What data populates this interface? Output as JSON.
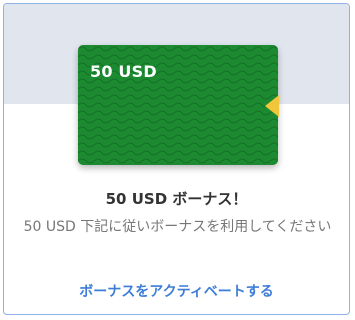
{
  "voucher": {
    "amount_label": "50 USD",
    "color": "#1b8a30",
    "accent_color": "#f3c53a"
  },
  "bonus": {
    "title": "50 USD ボーナス！",
    "description": "50 USD 下記に従いボーナスを利用してください",
    "action_label": "ボーナスをアクティベートする"
  },
  "colors": {
    "border": "#8fb1e6",
    "link": "#3d7dd8",
    "banner_bg": "#e1e6ee"
  }
}
